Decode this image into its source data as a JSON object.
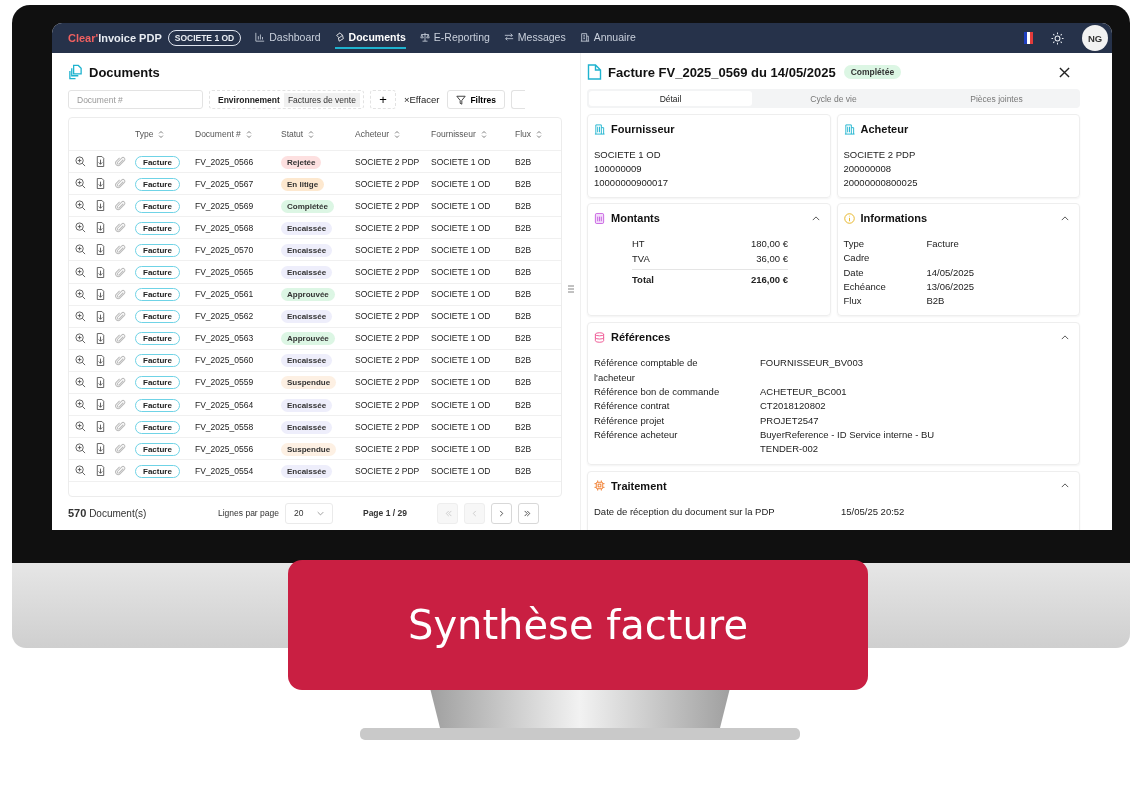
{
  "app": {
    "brand_accent": "Clear'",
    "brand": "Invoice PDP",
    "company": "SOCIETE 1 OD",
    "nav": [
      {
        "label": "Dashboard",
        "selected": false
      },
      {
        "label": "Documents",
        "selected": true
      },
      {
        "label": "E-Reporting",
        "selected": false
      },
      {
        "label": "Messages",
        "selected": false
      },
      {
        "label": "Annuaire",
        "selected": false
      }
    ],
    "avatar": "NG"
  },
  "documents": {
    "title": "Documents",
    "search": {
      "placeholder": "Document #"
    },
    "filter_label": "Environnement",
    "filter_value": "Factures de vente",
    "add": "+",
    "clear_icon": "×",
    "clear": "Effacer",
    "filters": "Filtres",
    "columns": [
      "Type",
      "Document #",
      "Statut",
      "Acheteur",
      "Fournisseur",
      "Flux"
    ],
    "rows": [
      {
        "type": "Facture",
        "document": "FV_2025_0566",
        "status": {
          "label": "Rejetée",
          "color": "#fde0e0"
        },
        "buyer": "SOCIETE 2 PDP",
        "supplier": "SOCIETE 1 OD",
        "flow": "B2B"
      },
      {
        "type": "Facture",
        "document": "FV_2025_0567",
        "status": {
          "label": "En litige",
          "color": "#fde8cf"
        },
        "buyer": "SOCIETE 2 PDP",
        "supplier": "SOCIETE 1 OD",
        "flow": "B2B"
      },
      {
        "type": "Facture",
        "document": "FV_2025_0569",
        "status": {
          "label": "Complétée",
          "color": "#dcf6e4"
        },
        "buyer": "SOCIETE 2 PDP",
        "supplier": "SOCIETE 1 OD",
        "flow": "B2B"
      },
      {
        "type": "Facture",
        "document": "FV_2025_0568",
        "status": {
          "label": "Encaissée",
          "color": "#eeeefb"
        },
        "buyer": "SOCIETE 2 PDP",
        "supplier": "SOCIETE 1 OD",
        "flow": "B2B"
      },
      {
        "type": "Facture",
        "document": "FV_2025_0570",
        "status": {
          "label": "Encaissée",
          "color": "#eeeefb"
        },
        "buyer": "SOCIETE 2 PDP",
        "supplier": "SOCIETE 1 OD",
        "flow": "B2B"
      },
      {
        "type": "Facture",
        "document": "FV_2025_0565",
        "status": {
          "label": "Encaissée",
          "color": "#eeeefb"
        },
        "buyer": "SOCIETE 2 PDP",
        "supplier": "SOCIETE 1 OD",
        "flow": "B2B"
      },
      {
        "type": "Facture",
        "document": "FV_2025_0561",
        "status": {
          "label": "Approuvée",
          "color": "#dcf6e4"
        },
        "buyer": "SOCIETE 2 PDP",
        "supplier": "SOCIETE 1 OD",
        "flow": "B2B"
      },
      {
        "type": "Facture",
        "document": "FV_2025_0562",
        "status": {
          "label": "Encaissée",
          "color": "#eeeefb"
        },
        "buyer": "SOCIETE 2 PDP",
        "supplier": "SOCIETE 1 OD",
        "flow": "B2B"
      },
      {
        "type": "Facture",
        "document": "FV_2025_0563",
        "status": {
          "label": "Approuvée",
          "color": "#dcf6e4"
        },
        "buyer": "SOCIETE 2 PDP",
        "supplier": "SOCIETE 1 OD",
        "flow": "B2B"
      },
      {
        "type": "Facture",
        "document": "FV_2025_0560",
        "status": {
          "label": "Encaissée",
          "color": "#eeeefb"
        },
        "buyer": "SOCIETE 2 PDP",
        "supplier": "SOCIETE 1 OD",
        "flow": "B2B"
      },
      {
        "type": "Facture",
        "document": "FV_2025_0559",
        "status": {
          "label": "Suspendue",
          "color": "#fdf0e3"
        },
        "buyer": "SOCIETE 2 PDP",
        "supplier": "SOCIETE 1 OD",
        "flow": "B2B"
      },
      {
        "type": "Facture",
        "document": "FV_2025_0564",
        "status": {
          "label": "Encaissée",
          "color": "#eeeefb"
        },
        "buyer": "SOCIETE 2 PDP",
        "supplier": "SOCIETE 1 OD",
        "flow": "B2B"
      },
      {
        "type": "Facture",
        "document": "FV_2025_0558",
        "status": {
          "label": "Encaissée",
          "color": "#eeeefb"
        },
        "buyer": "SOCIETE 2 PDP",
        "supplier": "SOCIETE 1 OD",
        "flow": "B2B"
      },
      {
        "type": "Facture",
        "document": "FV_2025_0556",
        "status": {
          "label": "Suspendue",
          "color": "#fdf0e3"
        },
        "buyer": "SOCIETE 2 PDP",
        "supplier": "SOCIETE 1 OD",
        "flow": "B2B"
      },
      {
        "type": "Facture",
        "document": "FV_2025_0554",
        "status": {
          "label": "Encaissée",
          "color": "#eeeefb"
        },
        "buyer": "SOCIETE 2 PDP",
        "supplier": "SOCIETE 1 OD",
        "flow": "B2B"
      }
    ],
    "count": "570",
    "count_label": "Document(s)",
    "rows_per_page_label": "Lignes par page",
    "rows_per_page": "20",
    "page": "Page 1 / 29",
    "pager": [
      {
        "kind": "first",
        "disabled": true
      },
      {
        "kind": "previous",
        "disabled": true
      },
      {
        "kind": "next",
        "disabled": false
      },
      {
        "kind": "last",
        "disabled": false
      }
    ]
  },
  "detail": {
    "title": "Facture FV_2025_0569 du 14/05/2025",
    "status": {
      "label": "Complétée",
      "color": "#dcf6e4"
    },
    "tabs": [
      {
        "label": "Détail",
        "selected": true
      },
      {
        "label": "Cycle de vie",
        "selected": false
      },
      {
        "label": "Pièces jointes",
        "selected": false
      }
    ],
    "parties": [
      {
        "title": "Fournisseur",
        "lines": [
          "SOCIETE 1 OD",
          "100000009",
          "10000000900017"
        ]
      },
      {
        "title": "Acheteur",
        "lines": [
          "SOCIETE 2 PDP",
          "200000008",
          "20000000800025"
        ]
      }
    ],
    "amounts": {
      "title": "Montants",
      "expanded": true,
      "rows": [
        {
          "label": "HT",
          "value": "180,00 €",
          "total": false
        },
        {
          "label": "TVA",
          "value": "36,00 €",
          "total": false
        },
        {
          "label": "Total",
          "value": "216,00 €",
          "total": true
        }
      ]
    },
    "information": {
      "title": "Informations",
      "expanded": true,
      "rows": [
        {
          "label": "Type",
          "value": "Facture"
        },
        {
          "label": "Cadre"
        },
        {
          "label": "Date",
          "value": "14/05/2025"
        },
        {
          "label": "Echéance",
          "value": "13/06/2025"
        },
        {
          "label": "Flux",
          "value": "B2B"
        }
      ]
    },
    "references": {
      "title": "Références",
      "expanded": true,
      "rows": [
        {
          "label": "Référence comptable de l'acheteur",
          "value": "FOURNISSEUR_BV003"
        },
        {
          "label": "Référence bon de commande",
          "value": "ACHETEUR_BC001"
        },
        {
          "label": "Référence contrat",
          "value": "CT2018120802"
        },
        {
          "label": "Référence projet",
          "value": "PROJET2547"
        },
        {
          "label": "Référence acheteur",
          "value": "BuyerReference - ID Service interne - BU TENDER-002"
        }
      ]
    },
    "processing": {
      "title": "Traitement",
      "expanded": true,
      "rows": [
        {
          "label": "Date de réception du document sur la PDP",
          "value": "15/05/25 20:52"
        }
      ]
    }
  },
  "banner": {
    "text": "Synthèse facture"
  }
}
